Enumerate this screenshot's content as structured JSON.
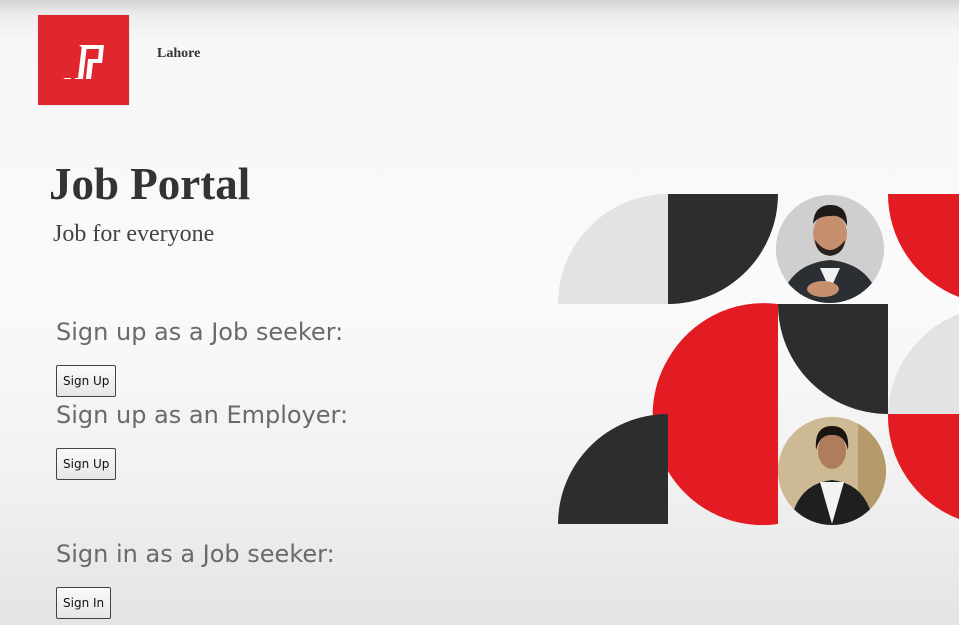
{
  "header": {
    "logo_text": "JP",
    "city": "Lahore"
  },
  "hero": {
    "title": "Job Portal",
    "tagline": "Job for everyone"
  },
  "sections": {
    "job_seeker_signup": {
      "label": "Sign up as a Job seeker:",
      "button": "Sign Up"
    },
    "employer_signup": {
      "label": "Sign up as an Employer:",
      "button": "Sign Up"
    },
    "job_seeker_signin": {
      "label": "Sign in as a Job seeker:",
      "button": "Sign In"
    }
  },
  "colors": {
    "brand_red": "#e0272d",
    "dark": "#2d2d2f",
    "light_gray": "#e3e3e3",
    "text": "#333333"
  }
}
